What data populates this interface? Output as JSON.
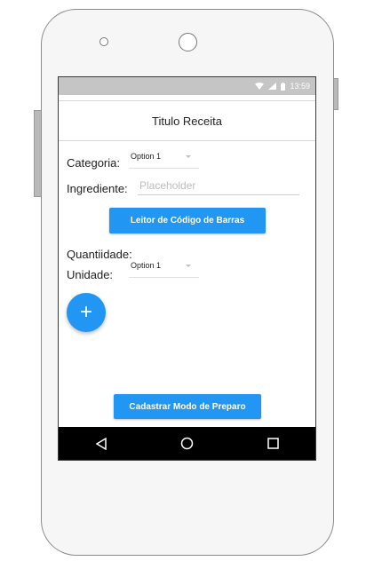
{
  "status_bar": {
    "time": "13:59"
  },
  "header": {
    "title": "Titulo Receita"
  },
  "form": {
    "category_label": "Categoria:",
    "category_value": "Option 1",
    "ingredient_label": "Ingrediente:",
    "ingredient_placeholder": "Placeholder",
    "barcode_button": "Leitor de Código de Barras",
    "quantity_label": "Quantiidade:",
    "unit_label": "Unidade:",
    "unit_value": "Option 1",
    "add_button": "+",
    "submit_button": "Cadastrar Modo de Preparo"
  },
  "colors": {
    "accent": "#2196f3",
    "status_bar": "#c5c5c5",
    "nav_bar": "#000000"
  },
  "icons": [
    "wifi-icon",
    "signal-icon",
    "battery-icon",
    "back-icon",
    "home-icon",
    "recents-icon"
  ]
}
